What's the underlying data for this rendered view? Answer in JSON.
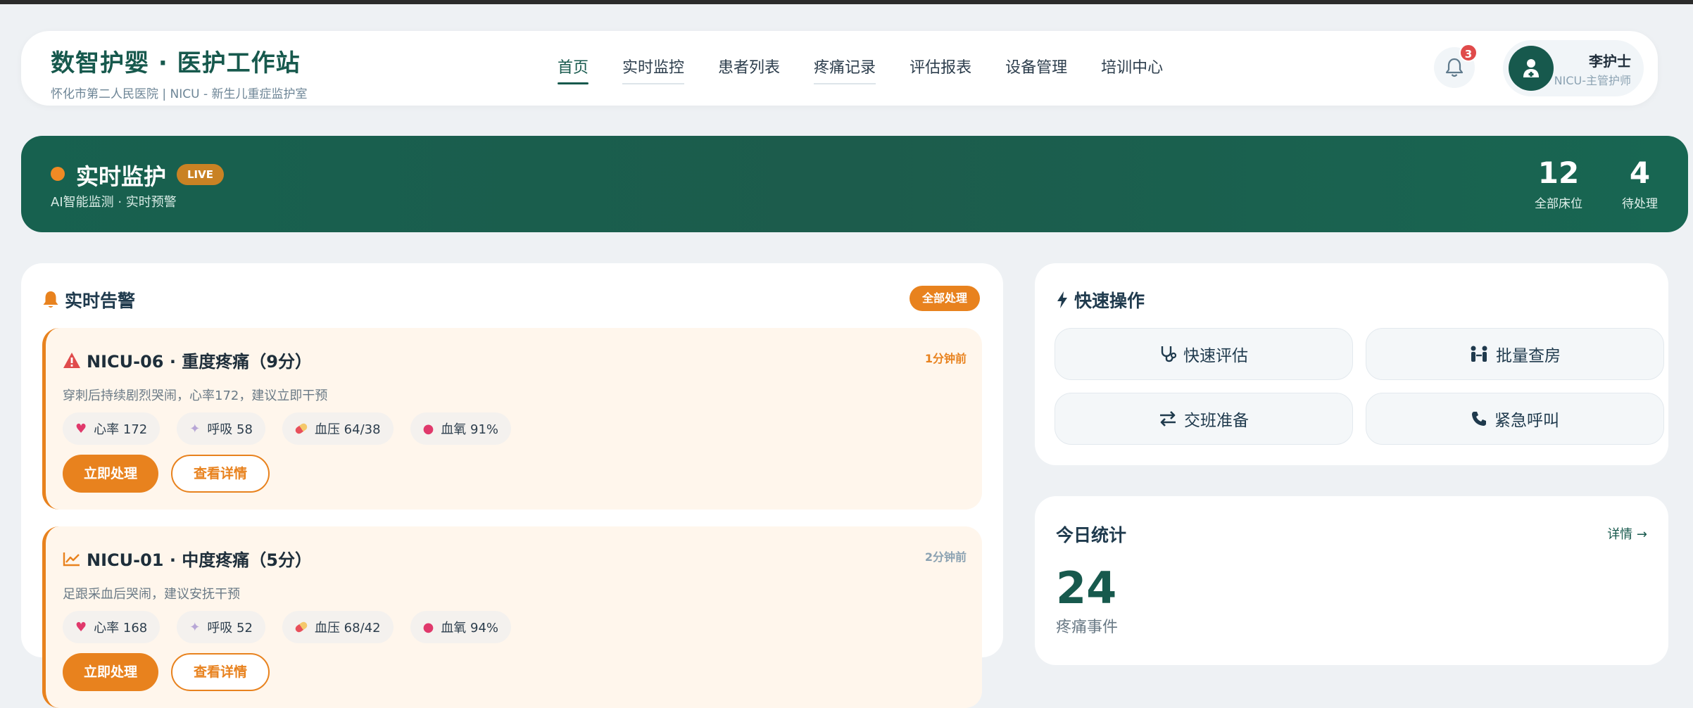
{
  "brand": {
    "title": "数智护婴 · 医护工作站",
    "subtitle": "怀化市第二人民医院 | NICU - 新生儿重症监护室"
  },
  "nav": [
    "首页",
    "实时监控",
    "患者列表",
    "疼痛记录",
    "评估报表",
    "设备管理",
    "培训中心"
  ],
  "nav_active": "首页",
  "notifications": {
    "count": "3"
  },
  "user": {
    "name": "李护士",
    "role": "NICU-主管护师"
  },
  "banner": {
    "title": "实时监护",
    "live": "LIVE",
    "subtitle": "AI智能监测 · 实时预警",
    "stats": [
      {
        "value": "12",
        "label": "全部床位"
      },
      {
        "value": "4",
        "label": "待处理"
      }
    ]
  },
  "alerts_panel": {
    "title": "实时告警",
    "handle_all": "全部处理",
    "alerts": [
      {
        "title": "NICU-06 · 重度疼痛（9分）",
        "icon": "warning-triangle-icon",
        "time": "1分钟前",
        "desc": "穿刺后持续剧烈哭闹，心率172，建议立即干预",
        "vitals": [
          "心率 172",
          "呼吸 58",
          "血压 64/38",
          "血氧 91%"
        ],
        "primary": "立即处理",
        "secondary": "查看详情"
      },
      {
        "title": "NICU-01 · 中度疼痛（5分）",
        "icon": "trend-line-icon",
        "time": "2分钟前",
        "desc": "足跟采血后哭闹，建议安抚干预",
        "vitals": [
          "心率 168",
          "呼吸 52",
          "血压 68/42",
          "血氧 94%"
        ],
        "primary": "立即处理",
        "secondary": "查看详情"
      }
    ]
  },
  "quick_actions": {
    "title": "快速操作",
    "items": [
      "快速评估",
      "批量查房",
      "交班准备",
      "紧急呼叫"
    ]
  },
  "today_stats": {
    "title": "今日统计",
    "link": "详情 →",
    "value": "24",
    "label": "疼痛事件"
  },
  "colors": {
    "primary": "#17594d",
    "accent": "#e8821e",
    "danger": "#e04b4b"
  }
}
